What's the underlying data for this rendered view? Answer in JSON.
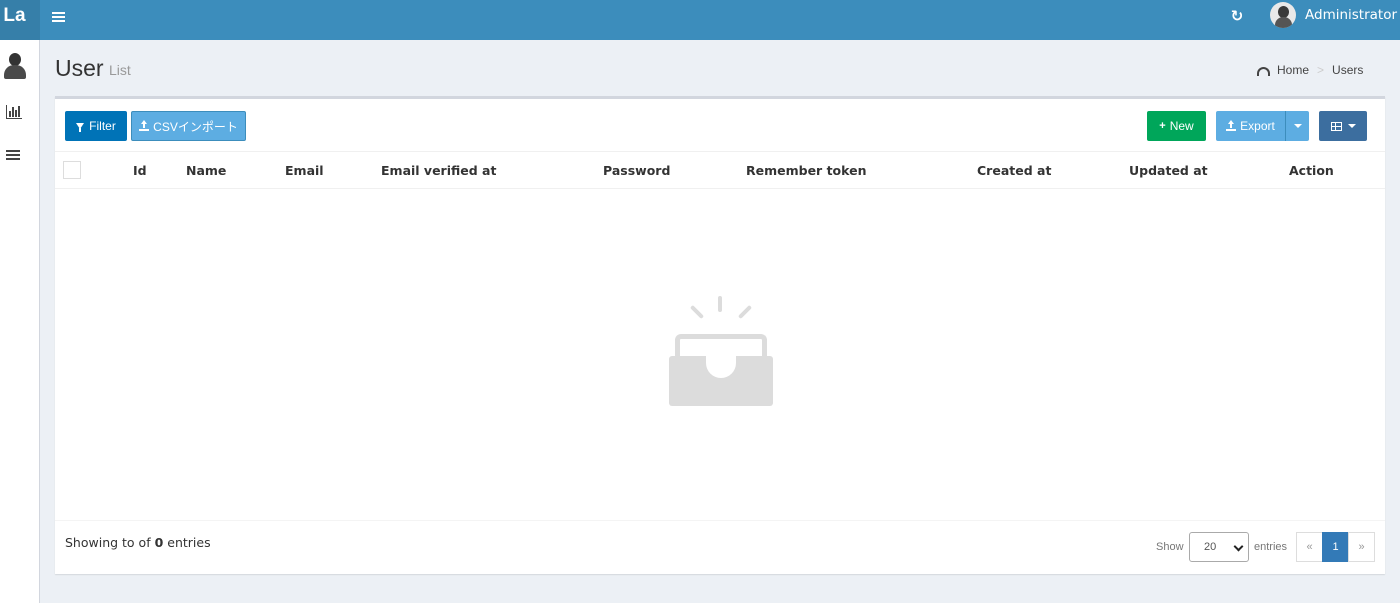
{
  "app": {
    "logo": "La"
  },
  "header": {
    "user_name": "Administrator",
    "refresh_icon": "refresh-icon",
    "menu_icon": "hamburger-icon"
  },
  "sidebar": {
    "icons": [
      "avatar",
      "bar-chart-icon",
      "table-icon"
    ]
  },
  "page": {
    "title": "User",
    "subtitle": "List"
  },
  "breadcrumb": {
    "home": "Home",
    "separator": ">",
    "current": "Users"
  },
  "toolbar": {
    "filter_label": "Filter",
    "csv_import_label": "CSVインポート",
    "new_label": "New",
    "export_label": "Export"
  },
  "table": {
    "columns": [
      "Id",
      "Name",
      "Email",
      "Email verified at",
      "Password",
      "Remember token",
      "Created at",
      "Updated at",
      "Action"
    ],
    "rows": []
  },
  "footer": {
    "showing_prefix": "Showing to of",
    "total": "0",
    "showing_suffix": "entries",
    "show_label": "Show",
    "per_page": "20",
    "entries_label": "entries",
    "pagination": {
      "prev": "«",
      "current": "1",
      "next": "»"
    }
  },
  "colors": {
    "header_bg": "#3c8dbc",
    "logo_bg": "#367fa9",
    "filter_btn": "#0073b7",
    "new_btn": "#00a65a",
    "export_btn": "#5dade2",
    "columns_btn": "#3c6e9f",
    "active_page": "#337ab7"
  }
}
